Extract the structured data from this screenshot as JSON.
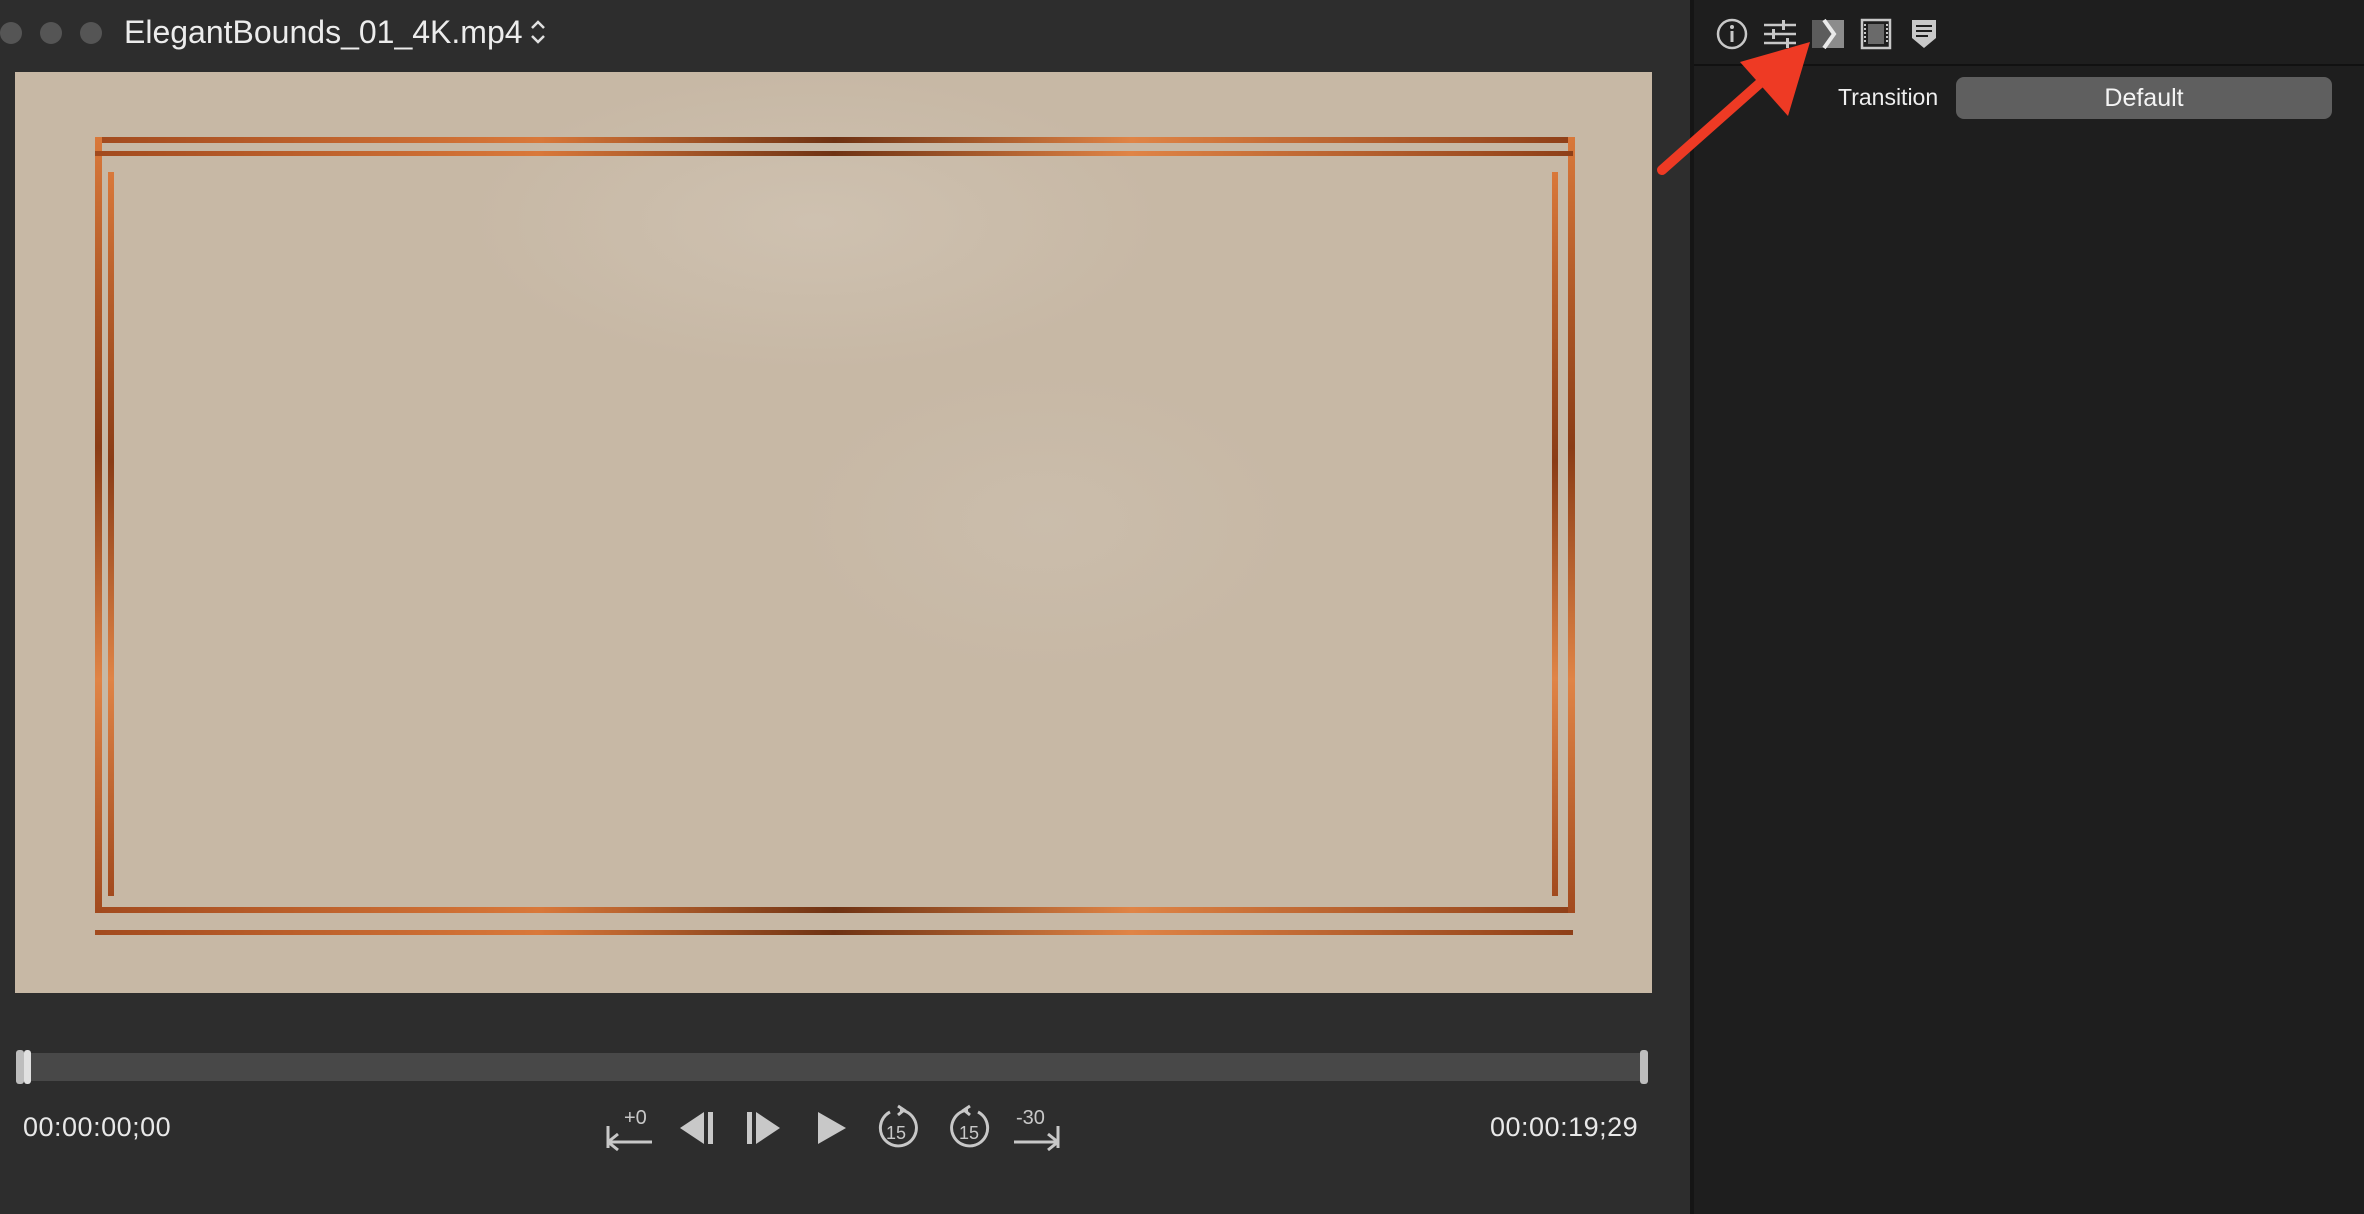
{
  "window": {
    "title": "ElegantBounds_01_4K.mp4"
  },
  "player": {
    "timecode_start": "00:00:00;00",
    "timecode_end": "00:00:19;29",
    "controls": {
      "jump_start_label": "+0",
      "rewind_label": "15",
      "forward_label": "15",
      "jump_end_label": "-30"
    }
  },
  "inspector": {
    "tabs": [
      "info-icon",
      "sliders-icon",
      "transition-icon",
      "filmstrip-icon",
      "marker-icon"
    ],
    "active_tab": "transition-icon",
    "transition_label": "Transition",
    "transition_value": "Default"
  },
  "colors": {
    "annotation_arrow": "#ee3a24",
    "frame_copper": "#c8652e",
    "video_bg": "#c7b8a5"
  }
}
